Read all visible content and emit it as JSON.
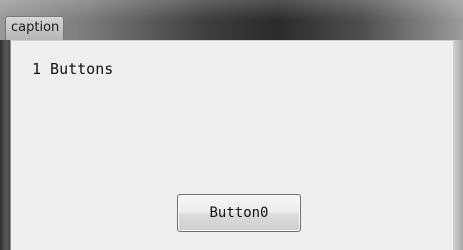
{
  "window": {
    "title": "caption"
  },
  "content": {
    "label": "1 Buttons",
    "button_label": "Button0"
  }
}
